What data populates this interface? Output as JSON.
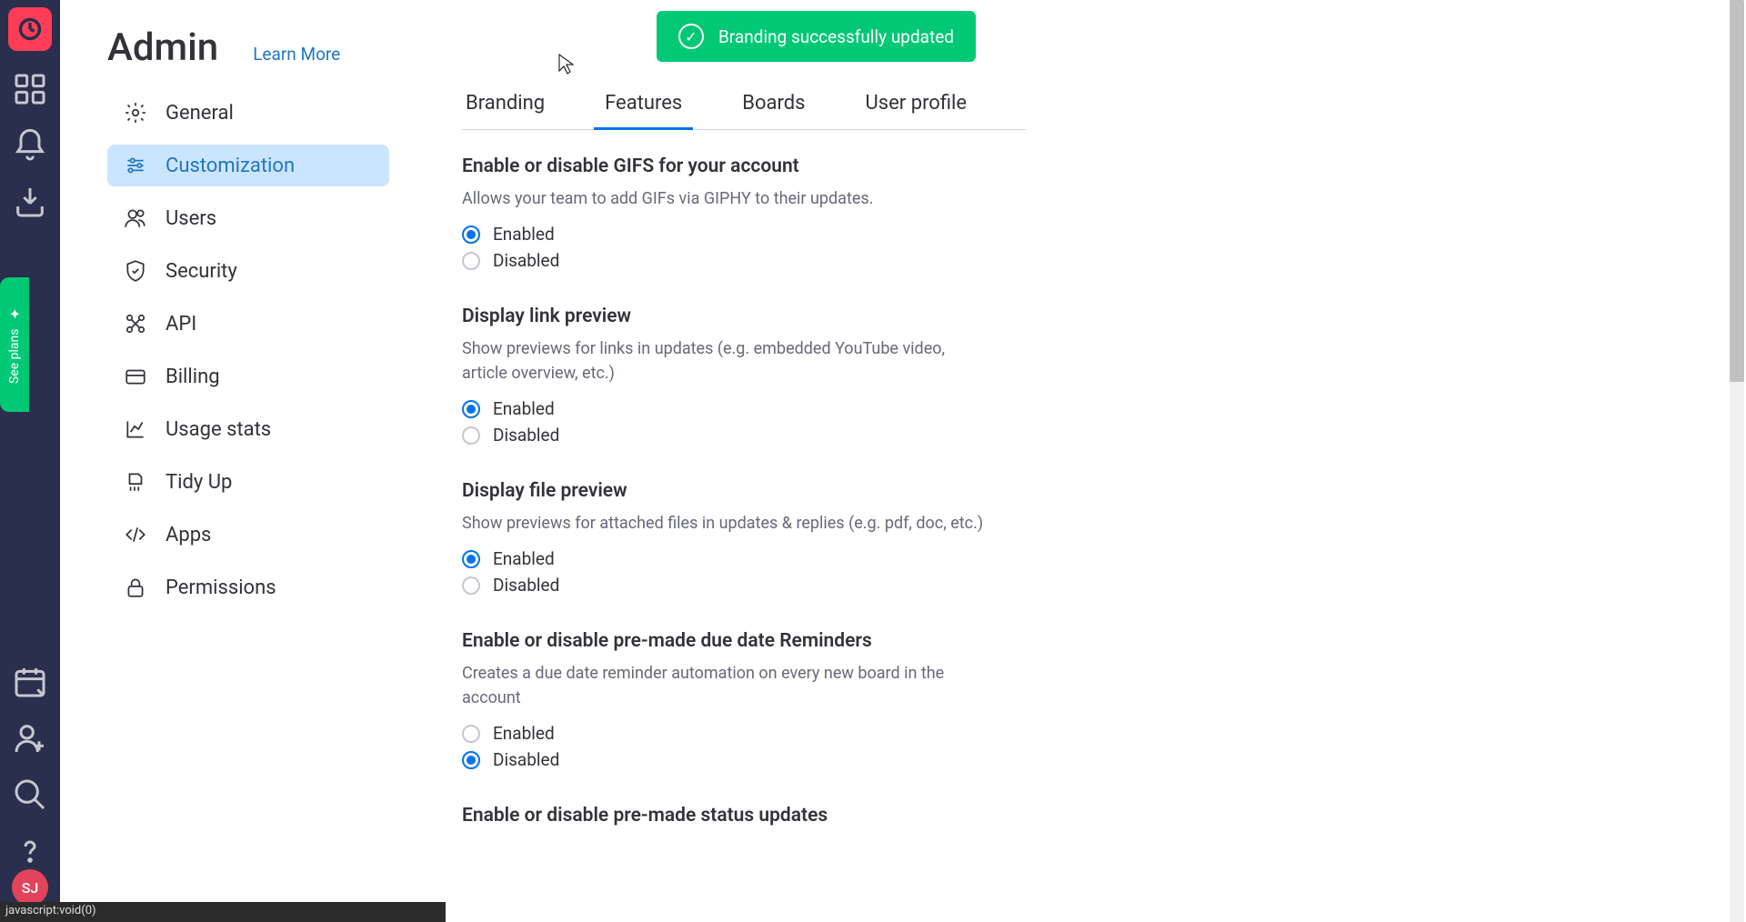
{
  "toast": {
    "message": "Branding successfully updated"
  },
  "page": {
    "title": "Admin",
    "learn_more": "Learn More"
  },
  "see_plans": {
    "label": "See plans"
  },
  "avatar": {
    "initials": "SJ"
  },
  "sidebar": {
    "items": [
      {
        "label": "General"
      },
      {
        "label": "Customization"
      },
      {
        "label": "Users"
      },
      {
        "label": "Security"
      },
      {
        "label": "API"
      },
      {
        "label": "Billing"
      },
      {
        "label": "Usage stats"
      },
      {
        "label": "Tidy Up"
      },
      {
        "label": "Apps"
      },
      {
        "label": "Permissions"
      }
    ]
  },
  "tabs": {
    "items": [
      {
        "label": "Branding"
      },
      {
        "label": "Features"
      },
      {
        "label": "Boards"
      },
      {
        "label": "User profile"
      }
    ]
  },
  "settings": [
    {
      "title": "Enable or disable GIFS for your account",
      "desc": "Allows your team to add GIFs via GIPHY to their updates.",
      "options": [
        {
          "label": "Enabled",
          "checked": true
        },
        {
          "label": "Disabled",
          "checked": false
        }
      ]
    },
    {
      "title": "Display link preview",
      "desc": "Show previews for links in updates (e.g. embedded YouTube video, article overview, etc.)",
      "options": [
        {
          "label": "Enabled",
          "checked": true
        },
        {
          "label": "Disabled",
          "checked": false
        }
      ]
    },
    {
      "title": "Display file preview",
      "desc": "Show previews for attached files in updates & replies (e.g. pdf, doc, etc.)",
      "options": [
        {
          "label": "Enabled",
          "checked": true
        },
        {
          "label": "Disabled",
          "checked": false
        }
      ]
    },
    {
      "title": "Enable or disable pre-made due date Reminders",
      "desc": "Creates a due date reminder automation on every new board in the account",
      "options": [
        {
          "label": "Enabled",
          "checked": false
        },
        {
          "label": "Disabled",
          "checked": true
        }
      ]
    },
    {
      "title": "Enable or disable pre-made status updates",
      "desc": "",
      "options": []
    }
  ],
  "status_bar": {
    "text": "javascript:void(0)"
  }
}
